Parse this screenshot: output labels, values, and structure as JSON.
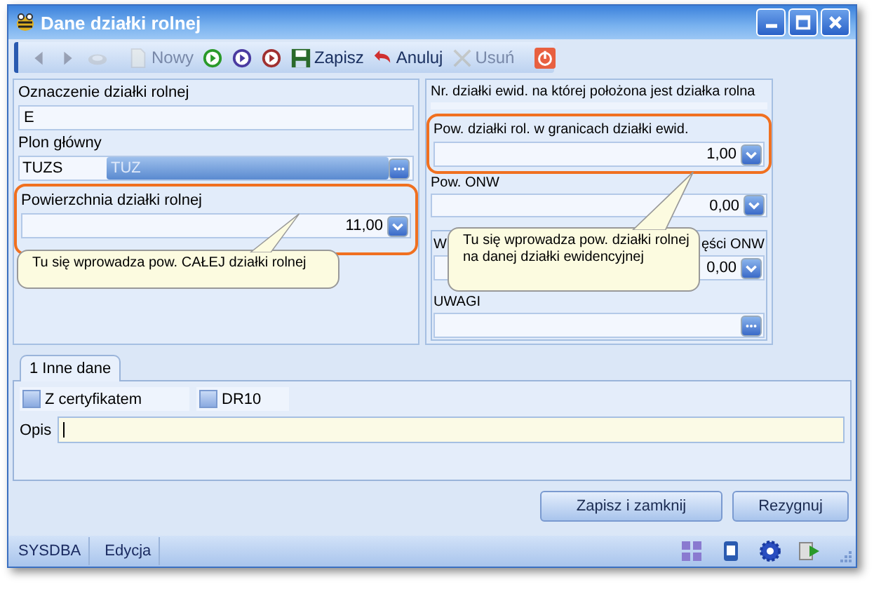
{
  "window": {
    "title": "Dane działki rolnej"
  },
  "toolbar": {
    "items": [
      {
        "disabled": true
      },
      {
        "disabled": true
      },
      {
        "disabled": true
      },
      {
        "label": "Nowy",
        "disabled": true
      },
      {
        "disabled": false
      },
      {
        "disabled": false
      },
      {
        "disabled": false
      },
      {
        "label": "Zapisz",
        "disabled": false
      },
      {
        "label": "Anuluj",
        "disabled": false
      },
      {
        "label": "Usuń",
        "disabled": true
      },
      {
        "disabled": false
      }
    ]
  },
  "left_panel": {
    "designation": {
      "label": "Oznaczenie działki rolnej",
      "value": "E"
    },
    "main_crop": {
      "label": "Plon główny",
      "code": "TUZS",
      "name": "TUZ"
    },
    "area": {
      "label": "Powierzchnia działki rolnej",
      "value": "11,00",
      "highlighted": true
    }
  },
  "right_panel": {
    "parcel_number": {
      "label": "Nr. działki ewid. na której położona jest działka rolna"
    },
    "area_within": {
      "label": "Pow. działki rol. w granicach działki ewid.",
      "value": "1,00",
      "highlighted": true
    },
    "onw_area": {
      "label": "Pow. ONW",
      "value": "0,00"
    },
    "onw_part": {
      "label_start": "W",
      "label_end": "ęści ONW",
      "value": "0,00"
    },
    "remarks": {
      "label": "UWAGI"
    }
  },
  "tooltips": [
    {
      "text": "Tu się wprowadza pow. CAŁEJ działki rolnej"
    },
    {
      "text": "Tu się wprowadza pow. działki rolnej\nna danej działki ewidencyjnej"
    }
  ],
  "tabs": [
    {
      "label": "1 Inne dane",
      "selected": true
    }
  ],
  "checkboxes": [
    {
      "label": "Z certyfikatem",
      "checked": false
    },
    {
      "label": "DR10",
      "checked": false
    }
  ],
  "description": {
    "label": "Opis"
  },
  "buttons": [
    "Zapisz i zamknij",
    "Rezygnuj"
  ],
  "status_bar": {
    "user": "SYSDBA",
    "mode": "Edycja"
  }
}
